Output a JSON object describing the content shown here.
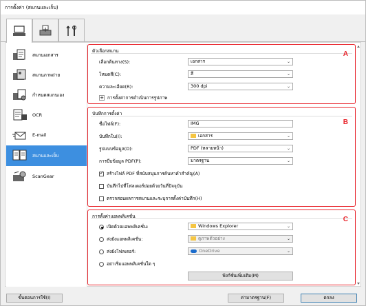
{
  "window": {
    "title": "การตั้งค่า (สแกนและเก็บ)"
  },
  "tabs": [
    {
      "icon": "scan-from-computer-icon"
    },
    {
      "icon": "scan-from-operation-panel-icon"
    },
    {
      "icon": "general-settings-icon"
    }
  ],
  "sidebar": {
    "items": [
      {
        "label": "สแกนเอกสาร",
        "icon": "document-scan-icon"
      },
      {
        "label": "สแกนภาพถ่าย",
        "icon": "photo-scan-icon"
      },
      {
        "label": "กำหนดสแกนเอง",
        "icon": "custom-scan-icon"
      },
      {
        "label": "OCR",
        "icon": "ocr-icon"
      },
      {
        "label": "E-mail",
        "icon": "email-icon"
      },
      {
        "label": "สแกนและเย็บ",
        "icon": "stitch-icon"
      },
      {
        "label": "ScanGear",
        "icon": "scangear-icon"
      }
    ]
  },
  "sectionA": {
    "title": "ตัวเลือกสแกน",
    "badge": "A",
    "fields": [
      {
        "label": "เลือกต้นทาง(S):",
        "value": "เอกสาร"
      },
      {
        "label": "โหมดสี(C):",
        "value": "สี"
      },
      {
        "label": "ความละเอียด(R):",
        "value": "300 dpi"
      }
    ],
    "expander_label": "การตั้งค่าการดำเนินการรูปภาพ"
  },
  "sectionB": {
    "title": "บันทึกการตั้งค่า",
    "badge": "B",
    "filename_label": "ชื่อไฟล์(F):",
    "filename_value": "IMG",
    "savein_label": "บันทึกใน(I):",
    "savein_value": "เอกสาร",
    "format_label": "รูปแบบข้อมูล(D):",
    "format_value": "PDF (หลายหน้า)",
    "compression_label": "การบีบข้อมูล PDF(P):",
    "compression_value": "มาตรฐาน",
    "check1": "สร้างไฟล์ PDF ที่สนับสนุนการค้นหาคำสำคัญ(A)",
    "check2": "บันทึกไปที่โฟลเดอร์ย่อยด้วยวันที่ปัจจุบัน",
    "check3": "ตรวจสอบผลการสแกนและระบุการตั้งค่าบันทึก(H)"
  },
  "sectionC": {
    "title": "การตั้งค่าแอพพลิเคชั่น",
    "badge": "C",
    "radio1": "เปิดด้วยแอพพลิเคชั่น:",
    "radio1_value": "Windows Explorer",
    "radio2": "ส่งยังแอพพลิเคชั่น:",
    "radio2_value": "ดูภาพตัวอย่าง",
    "radio3": "ส่งยังโฟลเดอร์:",
    "radio3_value": "OneDrive",
    "radio4": "อย่าเริ่มแอพพลิเคชั่นใด ๆ",
    "more_button": "ฟังก์ชั่นเพิ่มเติม(M)"
  },
  "footer": {
    "instructions": "ขั้นตอนการใช้(I)",
    "defaults": "ค่ามาตรฐาน(F)",
    "ok": "ตกลง"
  }
}
